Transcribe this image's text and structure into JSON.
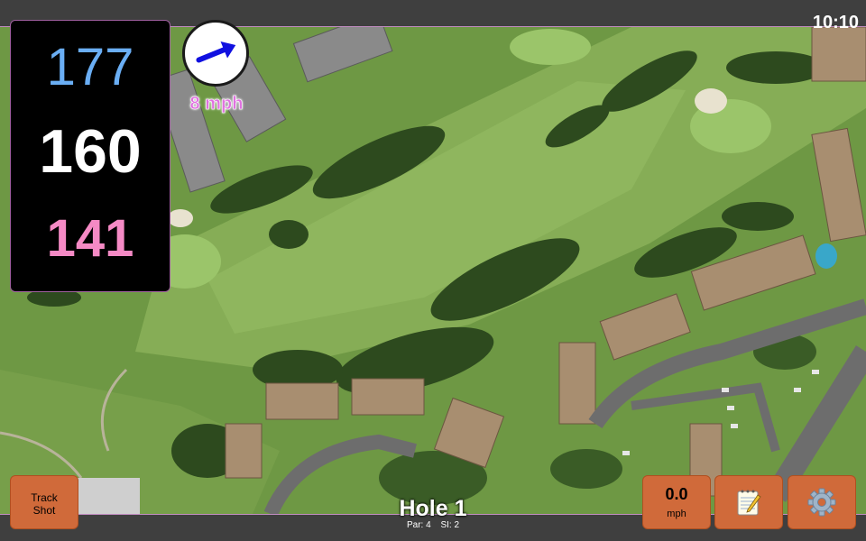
{
  "status_bar": {
    "time": "10:10"
  },
  "distances": {
    "back": "177",
    "center": "160",
    "front": "141"
  },
  "wind": {
    "speed_label": "8 mph",
    "direction": "east-north-east"
  },
  "hole": {
    "title": "Hole 1",
    "par_label": "Par: 4",
    "si_label": "SI: 2"
  },
  "buttons": {
    "track_shot_line1": "Track",
    "track_shot_line2": "Shot",
    "speed_value": "0.0",
    "speed_unit": "mph",
    "notes_icon": "notepad-icon",
    "settings_icon": "gear-icon"
  },
  "colors": {
    "back_distance": "#6aaef4",
    "center_distance": "#ffffff",
    "front_distance": "#f58ac5",
    "button": "#d06a3a",
    "wind_label": "#e070e0"
  }
}
